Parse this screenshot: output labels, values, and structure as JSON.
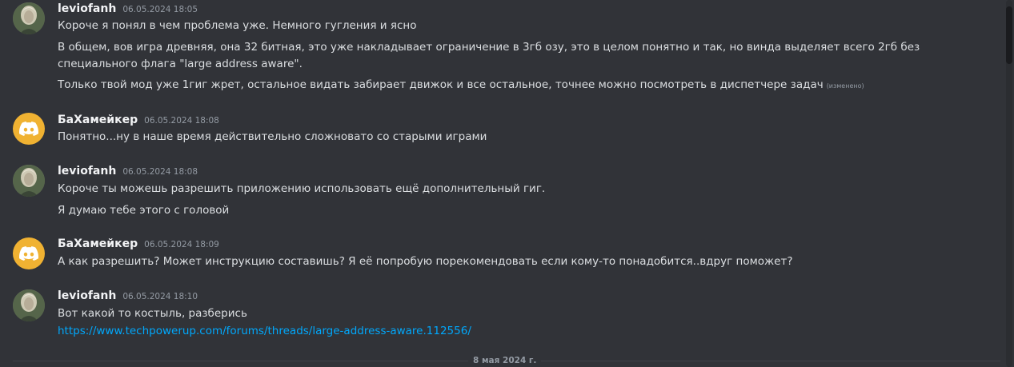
{
  "messages": [
    {
      "author": "leviofanh",
      "time": "06.05.2024 18:05",
      "avatar": "portrait-avatar",
      "lines": [
        "Короче я понял в чем проблема уже. Немного гугления и ясно",
        "В общем, вов игра древняя, она 32 битная, это уже накладывает ограничение в 3гб озу, это в целом понятно и так, но винда выделяет всего 2гб без",
        "специального флага \"large address aware\".",
        "Только твой мод уже 1гиг жрет, остальное видать забирает движок и все остальное, точнее можно посмотреть в диспетчере задач"
      ],
      "edited_label": "(изменено)"
    },
    {
      "author": "БаХамейкер",
      "time": "06.05.2024 18:08",
      "avatar": "discord-avatar",
      "lines": [
        "Понятно...ну в наше время действительно сложновато со старыми играми"
      ]
    },
    {
      "author": "leviofanh",
      "time": "06.05.2024 18:08",
      "avatar": "portrait-avatar",
      "lines": [
        "Короче ты можешь разрешить приложению использовать ещё дополнительный гиг.",
        "Я думаю тебе этого с головой"
      ]
    },
    {
      "author": "БаХамейкер",
      "time": "06.05.2024 18:09",
      "avatar": "discord-avatar",
      "lines": [
        "А как разрешить? Может инструкцию составишь? Я её попробую порекомендовать если кому-то понадобится..вдруг поможет?"
      ]
    },
    {
      "author": "leviofanh",
      "time": "06.05.2024 18:10",
      "avatar": "portrait-avatar",
      "lines": [
        "Вот какой то костыль, разберись"
      ],
      "link": "https://www.techpowerup.com/forums/threads/large-address-aware.112556/"
    }
  ],
  "date_divider": "8 мая 2024 г.",
  "colors": {
    "background": "#313338",
    "link": "#00a8fc",
    "discord_avatar": "#f0b232"
  }
}
